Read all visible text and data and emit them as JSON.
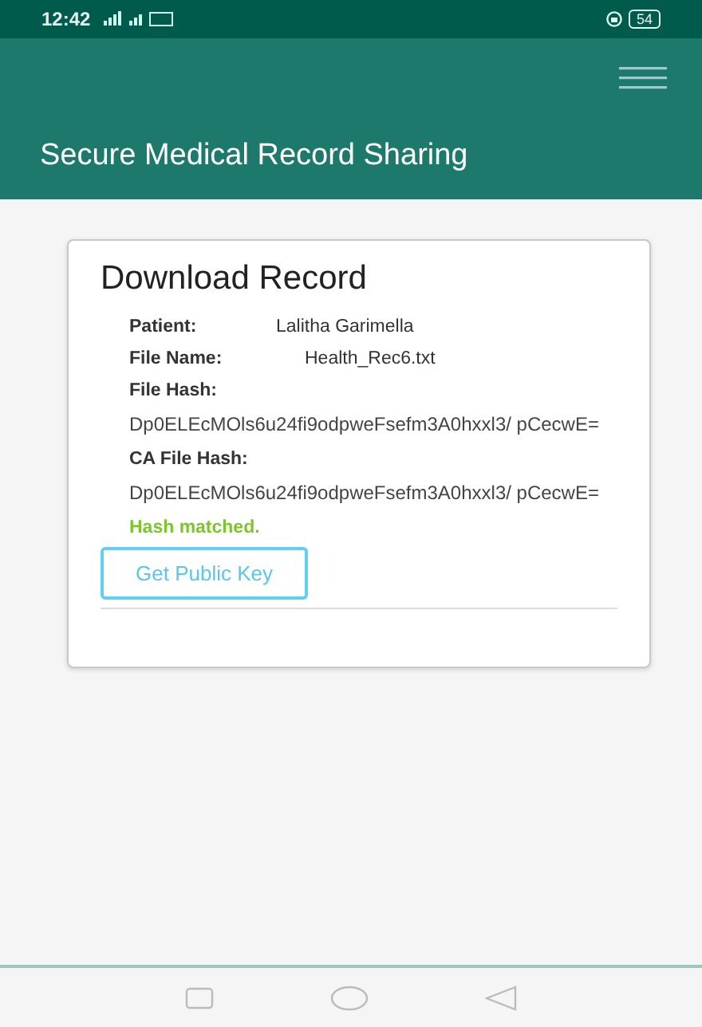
{
  "status_bar": {
    "time": "12:42",
    "battery": "54"
  },
  "app_bar": {
    "title": "Secure Medical Record Sharing"
  },
  "card": {
    "title": "Download Record",
    "fields": [
      {
        "kind": "inline",
        "label": "Patient:",
        "value": "Lalitha Garimella"
      },
      {
        "kind": "inline",
        "label": "File Name:",
        "value": "Health_Rec6.txt"
      },
      {
        "kind": "block",
        "label": "File Hash:",
        "value": "Dp0ELEcMOls6u24fi9odpweFsefm3A0hxxl3/ pCecwE="
      },
      {
        "kind": "block",
        "label": "CA File Hash:",
        "value": "Dp0ELEcMOls6u24fi9odpweFsefm3A0hxxl3/ pCecwE="
      }
    ],
    "status": "Hash matched.",
    "button": "Get Public Key"
  }
}
